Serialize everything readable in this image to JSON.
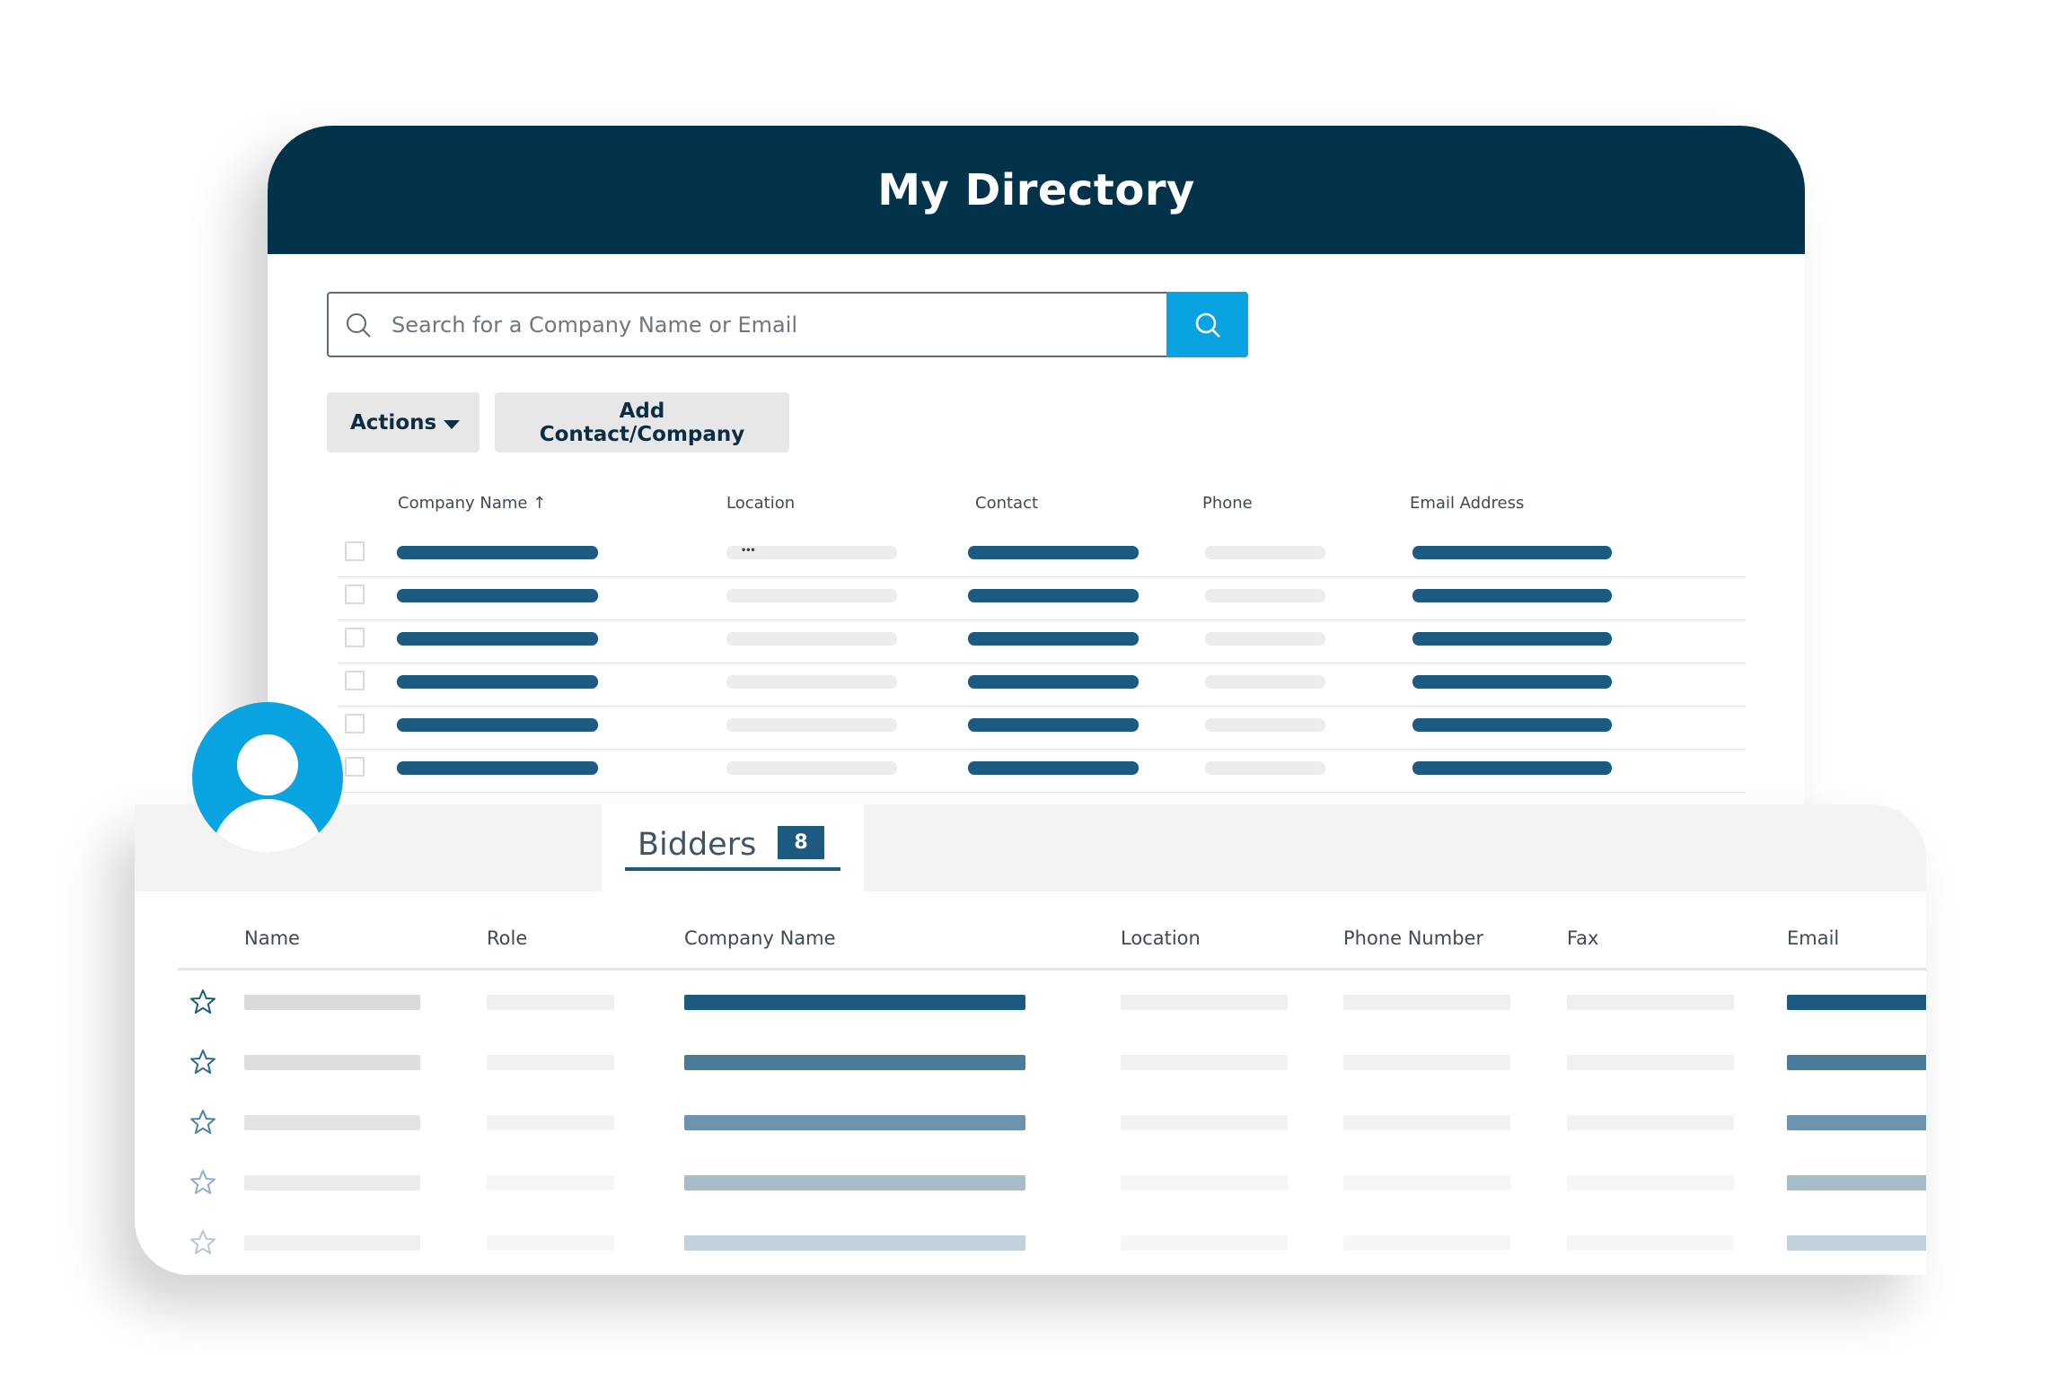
{
  "directory": {
    "title": "My Directory",
    "search": {
      "placeholder": "Search for a Company Name or Email",
      "value": ""
    },
    "actions_label": "Actions",
    "add_label": "Add Contact/Company",
    "columns": [
      "Company Name ↑",
      "Location",
      "Contact",
      "Phone",
      "Email Address"
    ],
    "row_count": 6
  },
  "bidders": {
    "tab_label": "Bidders",
    "count": "8",
    "columns": [
      "Name",
      "Role",
      "Company Name",
      "Location",
      "Phone Number",
      "Fax",
      "Email"
    ],
    "row_count": 5
  },
  "colors": {
    "header_bg": "#03324b",
    "accent_blue": "#0aa3e2",
    "primary_dark": "#1c5a80",
    "button_gray": "#e7e7e7"
  },
  "icons": {
    "search": "search-icon",
    "caret": "caret-down-icon",
    "sort": "sort-up-icon",
    "more": "more-icon",
    "star": "star-outline-icon",
    "user": "user-avatar-icon"
  }
}
